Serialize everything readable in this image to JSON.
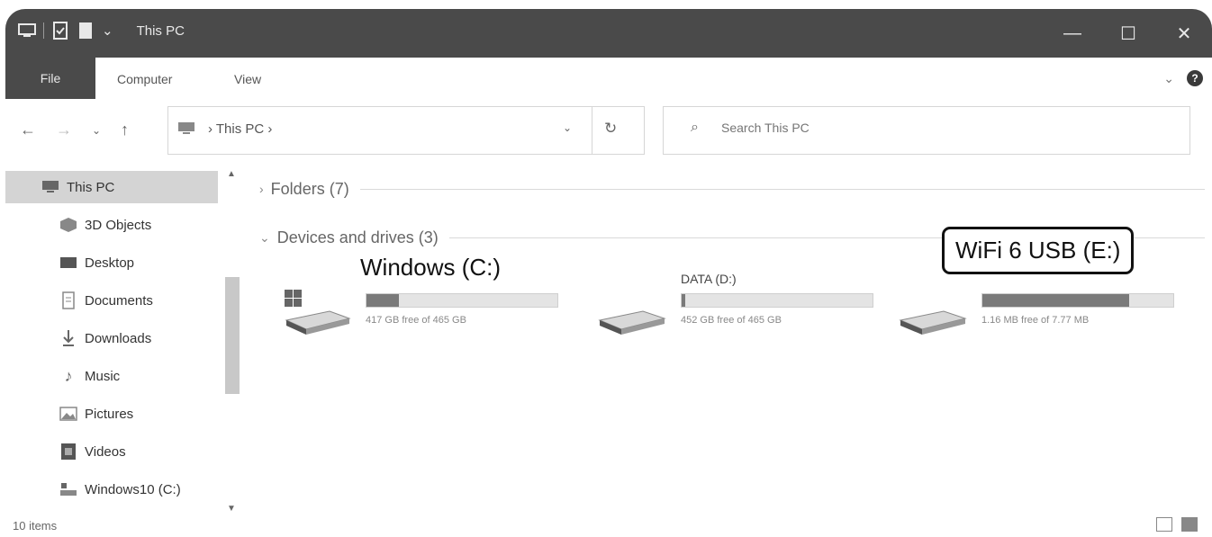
{
  "window": {
    "title": "This PC",
    "controls": {
      "minimize": "—",
      "maximize": "☐",
      "close": "✕"
    }
  },
  "quick_access": {
    "dropdown": "⌄"
  },
  "ribbon": {
    "tabs": [
      {
        "label": "File"
      },
      {
        "label": "Computer"
      },
      {
        "label": "View"
      }
    ],
    "expand": "⌄",
    "help": "?"
  },
  "nav": {
    "back": "←",
    "forward": "→",
    "recent": "⌄",
    "up": "↑",
    "breadcrumb": "›  This PC  ›",
    "dropdown": "⌄",
    "refresh": "↻"
  },
  "search": {
    "placeholder": "Search This PC",
    "icon": "⌕"
  },
  "sidebar": {
    "items": [
      {
        "label": "This PC",
        "icon": "pc-icon"
      },
      {
        "label": "3D Objects",
        "icon": "cube-icon"
      },
      {
        "label": "Desktop",
        "icon": "desktop-icon"
      },
      {
        "label": "Documents",
        "icon": "document-icon"
      },
      {
        "label": "Downloads",
        "icon": "download-icon"
      },
      {
        "label": "Music",
        "icon": "music-icon"
      },
      {
        "label": "Pictures",
        "icon": "pictures-icon"
      },
      {
        "label": "Videos",
        "icon": "video-icon"
      },
      {
        "label": "Windows10 (C:)",
        "icon": "drive-icon"
      }
    ],
    "scroll_up": "▲",
    "scroll_down": "▼",
    "selected_color": "#d4d4d4"
  },
  "content": {
    "folders_group": "Folders (7)",
    "devices_group": "Devices and drives (3)",
    "expand_chevron": "›",
    "collapse_chevron": "⌄",
    "drives": [
      {
        "name": "",
        "used_fraction": 0.17,
        "free_text": "417 GB free of 465 GB"
      },
      {
        "name": "DATA (D:)",
        "used_fraction": 0.02,
        "free_text": "452 GB free of 465 GB"
      },
      {
        "name": "",
        "used_fraction": 0.77,
        "free_text": "1.16 MB free of 7.77 MB"
      }
    ]
  },
  "callouts": {
    "windows": "Windows (C:)",
    "wifi": "WiFi 6 USB (E:)"
  },
  "status": {
    "item_count": "10 items"
  },
  "colors": {
    "titlebar": "#4a4a4a",
    "bar_fill": "#7a7a7a",
    "bar_track": "#e4e4e4"
  }
}
